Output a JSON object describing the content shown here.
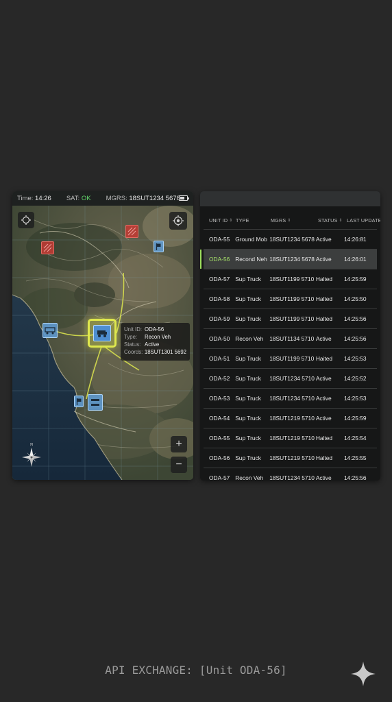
{
  "map": {
    "status": {
      "time_label": "Time:",
      "time_value": "14:26",
      "sat_label": "SAT:",
      "sat_value": "OK",
      "mgrs_label": "MGRS:",
      "mgrs_value": "18SUT1234 5678"
    },
    "popup": {
      "unit_id_label": "Unit ID:",
      "unit_id": "ODA-56",
      "type_label": "Type:",
      "type": "Recon Veh",
      "status_label": "Status:",
      "status": "Active",
      "coords_label": "Coords:",
      "coords": "18SUT1301 5692"
    },
    "zoom_in": "+",
    "zoom_out": "−",
    "compass_north": "N"
  },
  "table": {
    "headers": [
      "UNIT ID",
      "TYPE",
      "MGRS",
      "STATUS",
      "LAST UPDATED"
    ],
    "rows": [
      {
        "id": "ODA-55",
        "type": "Ground Mob",
        "mgrs": "18SUT1234 5678",
        "status": "Active",
        "updated": "14:26:81",
        "selected": false
      },
      {
        "id": "ODA-56",
        "type": "Recond Neh",
        "mgrs": "18SUT1234 5678",
        "status": "Active",
        "updated": "14:26:01",
        "selected": true
      },
      {
        "id": "ODA-57",
        "type": "Sup Truck",
        "mgrs": "18SUT1199 5710",
        "status": "Halted",
        "updated": "14:25:59",
        "selected": false
      },
      {
        "id": "ODA-58",
        "type": "Sup Truck",
        "mgrs": "18SUT1199 5710",
        "status": "Halted",
        "updated": "14:25:50",
        "selected": false
      },
      {
        "id": "ODA-59",
        "type": "Sup Truck",
        "mgrs": "18SUT1199 5710",
        "status": "Halted",
        "updated": "14:25:56",
        "selected": false
      },
      {
        "id": "ODA-50",
        "type": "Recon Veh",
        "mgrs": "18SUT1134 5710",
        "status": "Active",
        "updated": "14:25:56",
        "selected": false
      },
      {
        "id": "ODA-51",
        "type": "Sup Truck",
        "mgrs": "18SUT1199 5710",
        "status": "Haited",
        "updated": "14:25:53",
        "selected": false
      },
      {
        "id": "ODA-52",
        "type": "Sup Truck",
        "mgrs": "18SUT1234 5710",
        "status": "Active",
        "updated": "14:25:52",
        "selected": false
      },
      {
        "id": "ODA-53",
        "type": "Sup Truck",
        "mgrs": "18SUT1234 5710",
        "status": "Active",
        "updated": "14:25:53",
        "selected": false
      },
      {
        "id": "ODA-54",
        "type": "Sup Truck",
        "mgrs": "18SUT1219 5710",
        "status": "Active",
        "updated": "14:25:59",
        "selected": false
      },
      {
        "id": "ODA-55",
        "type": "Sup Truck",
        "mgrs": "18SUT1219 5710",
        "status": "Halted",
        "updated": "14:25:54",
        "selected": false
      },
      {
        "id": "ODA-56",
        "type": "Sup Truck",
        "mgrs": "18SUT1219 5710",
        "status": "Halted",
        "updated": "14:25:55",
        "selected": false
      },
      {
        "id": "ODA-57",
        "type": "Recon Veh",
        "mgrs": "18SUT1234 5710",
        "status": "Active",
        "updated": "14:25:56",
        "selected": false
      }
    ]
  },
  "footer": {
    "text": "API EXCHANGE: [Unit ODA-56]"
  },
  "colors": {
    "selected_accent": "#a6e06a",
    "sat_ok": "#62d36a",
    "hostile": "#c43a34",
    "friendly": "#609ed6",
    "selection_ring": "#dfe84e"
  }
}
